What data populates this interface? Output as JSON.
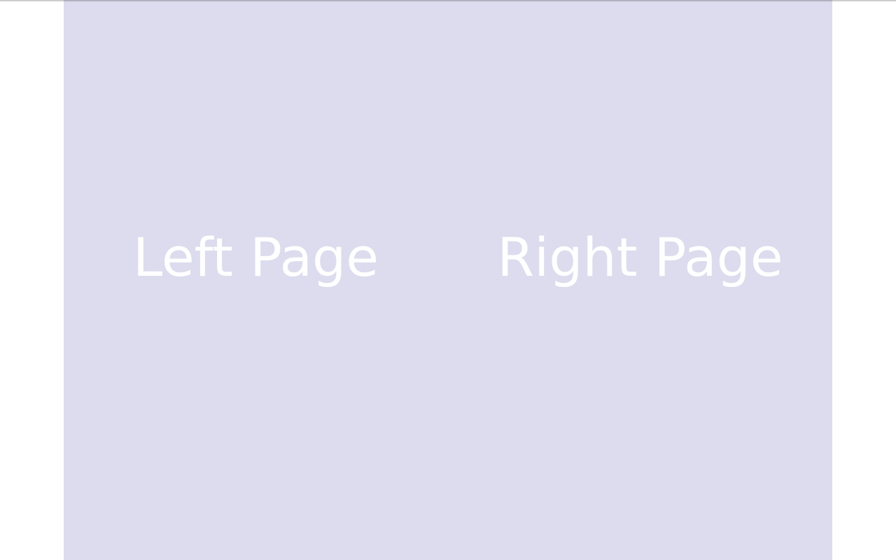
{
  "theme": {
    "page_background": "#dcdcee",
    "page_text_color": "#ffffff",
    "viewer_background": "#ffffff"
  },
  "spread": {
    "left_page": {
      "label": "Left Page"
    },
    "right_page": {
      "label": "Right Page"
    }
  }
}
